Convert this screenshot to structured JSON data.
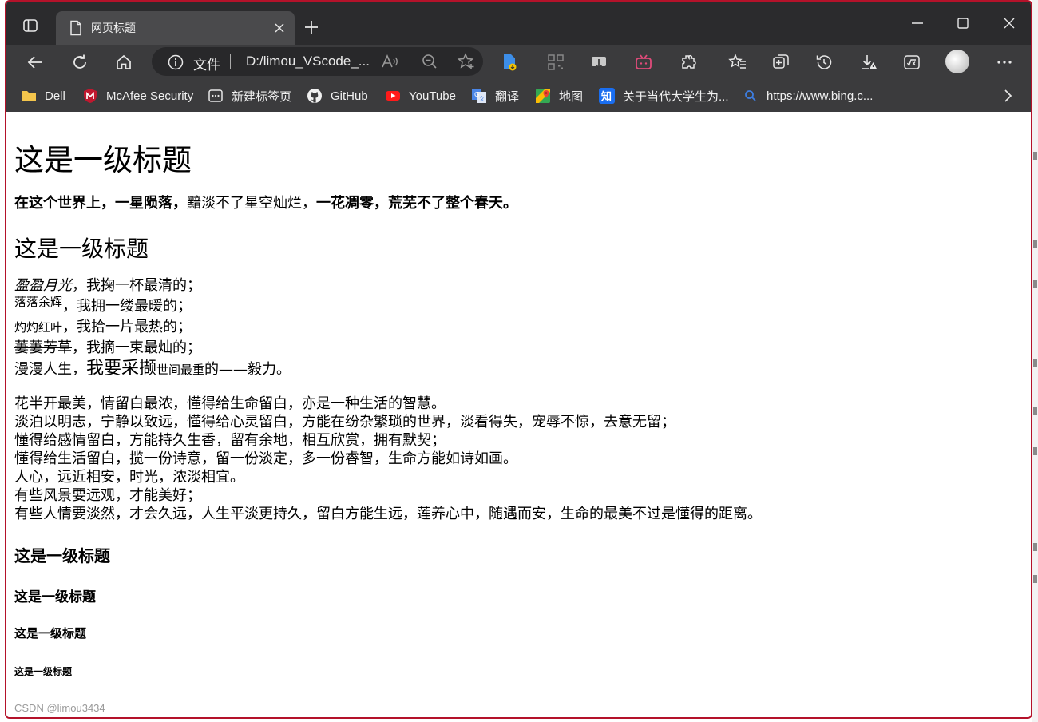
{
  "browser": {
    "tab": {
      "title": "网页标题",
      "icon": "page-icon"
    },
    "address": {
      "scheme_label": "文件",
      "url": "D:/limou_VScode_..."
    },
    "bookmarks": [
      {
        "label": "Dell",
        "icon": "folder-icon"
      },
      {
        "label": "McAfee Security",
        "icon": "mcafee-icon"
      },
      {
        "label": "新建标签页",
        "icon": "new-tab-page-icon"
      },
      {
        "label": "GitHub",
        "icon": "github-icon"
      },
      {
        "label": "YouTube",
        "icon": "youtube-icon"
      },
      {
        "label": "翻译",
        "icon": "translate-icon"
      },
      {
        "label": "地图",
        "icon": "maps-icon"
      },
      {
        "label": "关于当代大学生为...",
        "icon": "zhihu-icon"
      },
      {
        "label": "https://www.bing.c...",
        "icon": "search-icon"
      }
    ],
    "colors": {
      "frame": "#2b2b2d",
      "toolbar": "#3b3b3d",
      "border": "#b4122a"
    }
  },
  "page": {
    "h1": "这是一级标题",
    "p1": {
      "part1": "在这个世界上，一星陨落，",
      "part2": "黯淡不了星空灿烂，",
      "part3": "一花凋零，荒芜不了整个春天。"
    },
    "h2": "这是一级标题",
    "poem": {
      "l1_a": "盈盈月光",
      "l1_b": "，我掬一杯最清的；",
      "l2_a": "落落余辉",
      "l2_b": "，我拥一缕最暖的；",
      "l3_a": "灼灼红叶",
      "l3_b": "，我拾一片最热的；",
      "l4_a": "萋萋芳草",
      "l4_b": "，我摘一束最灿的；",
      "l5_a": "漫漫人生",
      "l5_b": "，",
      "l5_c": "我要采撷",
      "l5_d": "世间最重",
      "l5_e": "的——毅力。"
    },
    "paragraph": [
      "花半开最美，情留白最浓，懂得给生命留白，亦是一种生活的智慧。",
      "淡泊以明志，宁静以致远，懂得给心灵留白，方能在纷杂繁琐的世界，淡看得失，宠辱不惊，去意无留；",
      "懂得给感情留白，方能持久生香，留有余地，相互欣赏，拥有默契；",
      "懂得给生活留白，揽一份诗意，留一份淡定，多一份睿智，生命方能如诗如画。",
      "人心，远近相安，时光，浓淡相宜。",
      "有些风景要远观，才能美好；",
      "有些人情要淡然，才会久远，人生平淡更持久，留白方能生远，莲养心中，随遇而安，生命的最美不过是懂得的距离。"
    ],
    "h3": "这是一级标题",
    "h4": "这是一级标题",
    "h5": "这是一级标题",
    "h6": "这是一级标题"
  },
  "watermark": "CSDN @limou3434"
}
